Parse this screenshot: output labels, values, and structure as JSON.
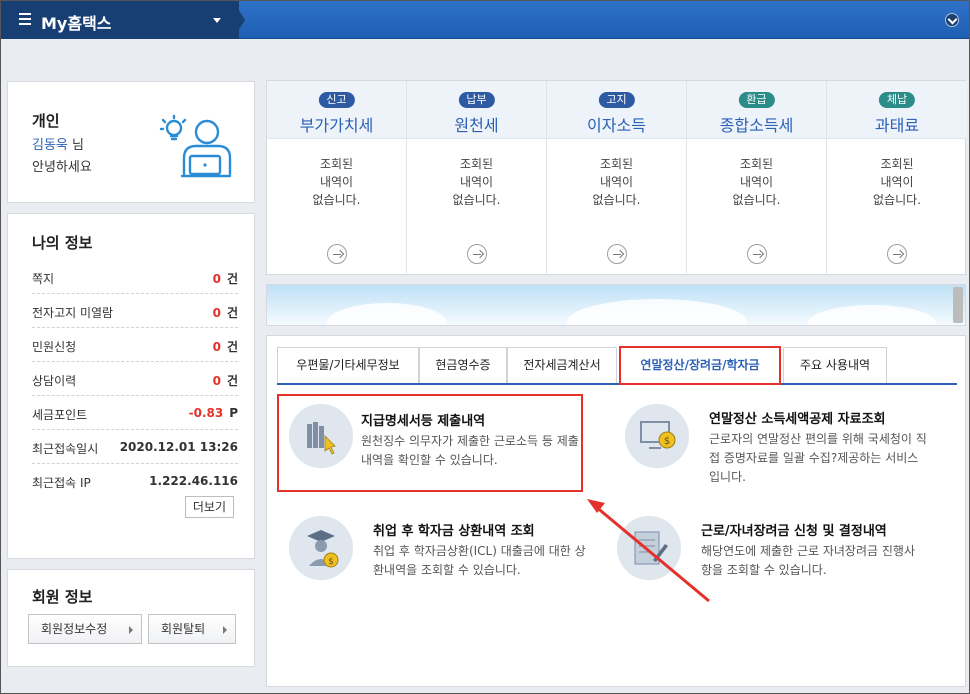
{
  "header": {
    "title": "My홈택스"
  },
  "profile": {
    "type": "개인",
    "name": "김동욱",
    "suffix": "님",
    "greeting": "안녕하세요"
  },
  "myinfo": {
    "title": "나의 정보",
    "rows": [
      {
        "label": "쪽지",
        "value": "0",
        "unit": "건"
      },
      {
        "label": "전자고지 미열람",
        "value": "0",
        "unit": "건"
      },
      {
        "label": "민원신청",
        "value": "0",
        "unit": "건"
      },
      {
        "label": "상담이력",
        "value": "0",
        "unit": "건"
      },
      {
        "label": "세금포인트",
        "value": "-0.83",
        "unit": "P"
      },
      {
        "label": "최근접속일시",
        "value": "2020.12.01 13:26",
        "unit": ""
      },
      {
        "label": "최근접속 IP",
        "value": "1.222.46.116",
        "unit": ""
      }
    ],
    "more_label": "더보기"
  },
  "member": {
    "title": "회원 정보",
    "edit_label": "회원정보수정",
    "withdraw_label": "회원탈퇴"
  },
  "tax_cards": [
    {
      "badge": "신고",
      "name": "부가가치세",
      "msg1": "조회된",
      "msg2": "내역이",
      "msg3": "없습니다."
    },
    {
      "badge": "납부",
      "name": "원천세",
      "msg1": "조회된",
      "msg2": "내역이",
      "msg3": "없습니다."
    },
    {
      "badge": "고지",
      "name": "이자소득",
      "msg1": "조회된",
      "msg2": "내역이",
      "msg3": "없습니다."
    },
    {
      "badge": "환급",
      "name": "종합소득세",
      "msg1": "조회된",
      "msg2": "내역이",
      "msg3": "없습니다."
    },
    {
      "badge": "체납",
      "name": "과태료",
      "msg1": "조회된",
      "msg2": "내역이",
      "msg3": "없습니다."
    }
  ],
  "tabs": [
    {
      "label": "우편물/기타세무정보"
    },
    {
      "label": "현금영수증"
    },
    {
      "label": "전자세금계산서"
    },
    {
      "label": "연말정산/장려금/학자금"
    },
    {
      "label": "주요 사용내역"
    }
  ],
  "services": [
    {
      "title": "지급명세서등 제출내역",
      "desc": "원천징수 의무자가 제출한 근로소득 등 제출내역을 확인할 수 있습니다."
    },
    {
      "title": "연말정산 소득세액공제 자료조회",
      "desc": "근로자의 연말정산 편의를 위해 국세청이 직접 증명자료를 일괄 수집?제공하는 서비스입니다."
    },
    {
      "title": "취업 후 학자금 상환내역 조회",
      "desc": "취업 후 학자금상환(ICL) 대출금에 대한 상환내역을 조회할 수 있습니다."
    },
    {
      "title": "근로/자녀장려금 신청 및 결정내역",
      "desc": "해당연도에 제출한 근로 자녀장려금 진행사항을 조회할 수 있습니다."
    }
  ],
  "colors": {
    "header_blue": "#2f72c8",
    "brand_navy": "#173f74",
    "accent_blue": "#2b61b6",
    "highlight_red": "#e4322b"
  }
}
